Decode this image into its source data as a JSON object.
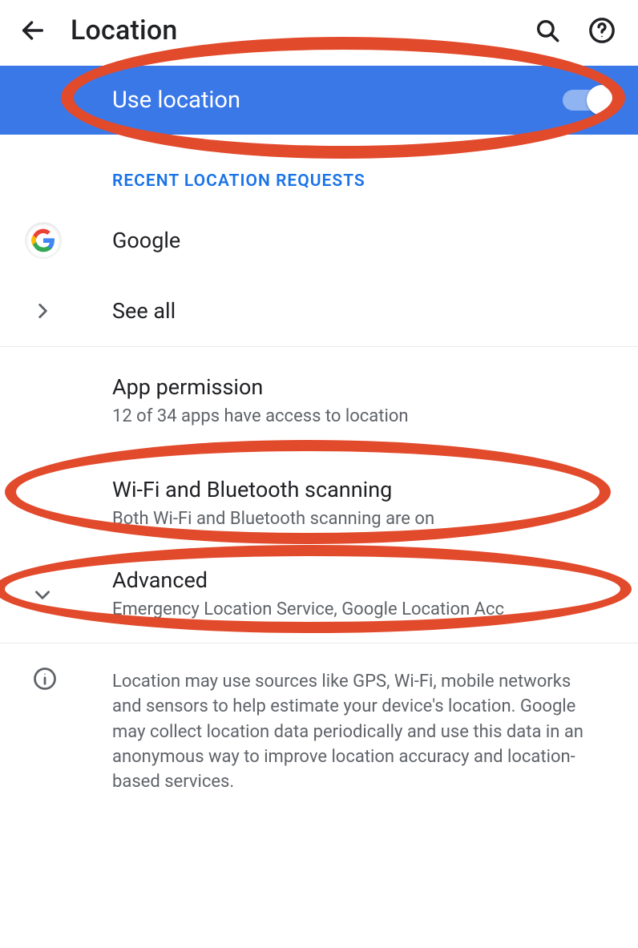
{
  "appbar": {
    "title": "Location"
  },
  "toggle": {
    "label": "Use location",
    "state": true
  },
  "section_header": "RECENT LOCATION REQUESTS",
  "recent": {
    "google": "Google",
    "see_all": "See all"
  },
  "items": {
    "app_permission": {
      "title": "App permission",
      "sub": "12 of 34 apps have access to location"
    },
    "scanning": {
      "title": "Wi-Fi and Bluetooth scanning",
      "sub": "Both Wi-Fi and Bluetooth scanning are on"
    },
    "advanced": {
      "title": "Advanced",
      "sub": "Emergency Location Service, Google Location Acc"
    }
  },
  "info_text": "Location may use sources like GPS, Wi-Fi, mobile networks and sensors to help estimate your device's location. Google may collect location data periodically and use this data in an anonymous way to improve location accuracy and location-based services."
}
